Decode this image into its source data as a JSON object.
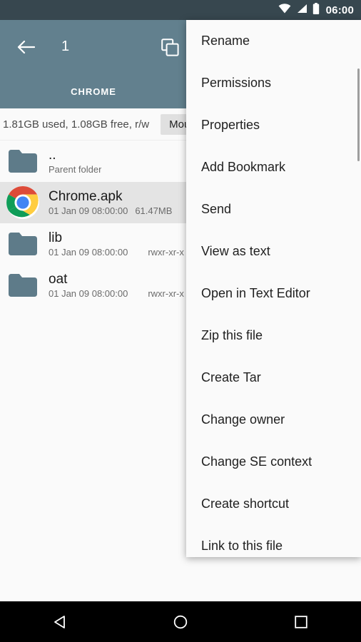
{
  "status_bar": {
    "time": "06:00",
    "icons": [
      "wifi-icon",
      "signal-icon",
      "battery-icon"
    ],
    "background": "#37474f"
  },
  "toolbar": {
    "background": "#62808e",
    "back_icon": "back-arrow-icon",
    "selection_count": "1",
    "copy_icon": "copy-icon"
  },
  "tabs": [
    {
      "label": "CHROME",
      "active": true
    }
  ],
  "content": {
    "storage_info": "1.81GB used, 1.08GB free, r/w",
    "mount_button_label": "Mount",
    "files": [
      {
        "icon": "folder-icon",
        "name": "..",
        "meta": "Parent folder",
        "selected": false
      },
      {
        "icon": "chrome-icon",
        "name": "Chrome.apk",
        "date": "01 Jan 09 08:00:00",
        "size": "61.47MB",
        "selected": true
      },
      {
        "icon": "folder-icon",
        "name": "lib",
        "date": "01 Jan 09 08:00:00",
        "permissions": "rwxr-xr-x",
        "selected": false
      },
      {
        "icon": "folder-icon",
        "name": "oat",
        "date": "01 Jan 09 08:00:00",
        "permissions": "rwxr-xr-x",
        "selected": false
      }
    ]
  },
  "context_menu": {
    "background": "#fafafa",
    "items": [
      {
        "label": "Rename"
      },
      {
        "label": "Permissions"
      },
      {
        "label": "Properties"
      },
      {
        "label": "Add Bookmark"
      },
      {
        "label": "Send"
      },
      {
        "label": "View as text"
      },
      {
        "label": "Open in Text Editor"
      },
      {
        "label": "Zip this file"
      },
      {
        "label": "Create Tar"
      },
      {
        "label": "Change owner"
      },
      {
        "label": "Change SE context"
      },
      {
        "label": "Create shortcut"
      },
      {
        "label": "Link to this file"
      }
    ]
  },
  "nav_bar": {
    "background": "#000000",
    "buttons": [
      "back-triangle-icon",
      "home-circle-icon",
      "recents-square-icon"
    ]
  },
  "colors": {
    "status_bar": "#37474f",
    "toolbar": "#62808e",
    "folder": "#5e7b89",
    "selected_row": "#e4e4e4",
    "page_background": "#fafafa"
  }
}
